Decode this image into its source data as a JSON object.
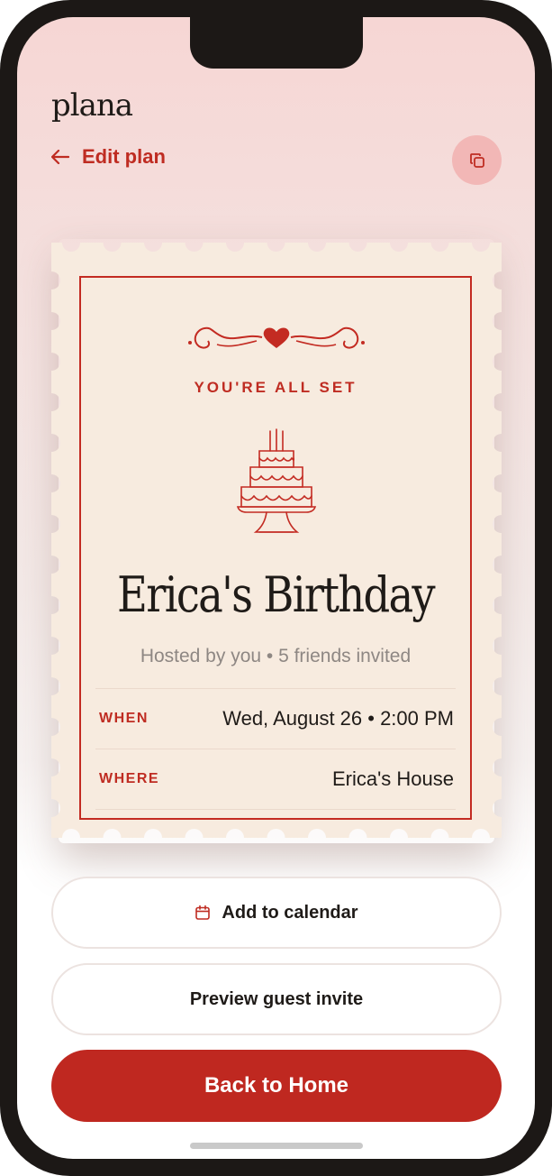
{
  "app": {
    "brand": "plana"
  },
  "header": {
    "back_label": "Edit plan",
    "copy_icon": "copy-icon"
  },
  "card": {
    "eyebrow": "YOU'RE ALL SET",
    "title": "Erica's Birthday",
    "subtitle": "Hosted by you • 5 friends invited",
    "rows": [
      {
        "label": "WHEN",
        "value": "Wed, August 26 • 2:00 PM"
      },
      {
        "label": "WHERE",
        "value": "Erica's House"
      }
    ]
  },
  "actions": {
    "add_calendar": "Add to calendar",
    "preview_invite": "Preview guest invite",
    "back_home": "Back to Home"
  },
  "colors": {
    "accent": "#bf2820",
    "stamp_bg": "#f7ebdf",
    "copy_bg": "#f2b7b6"
  }
}
